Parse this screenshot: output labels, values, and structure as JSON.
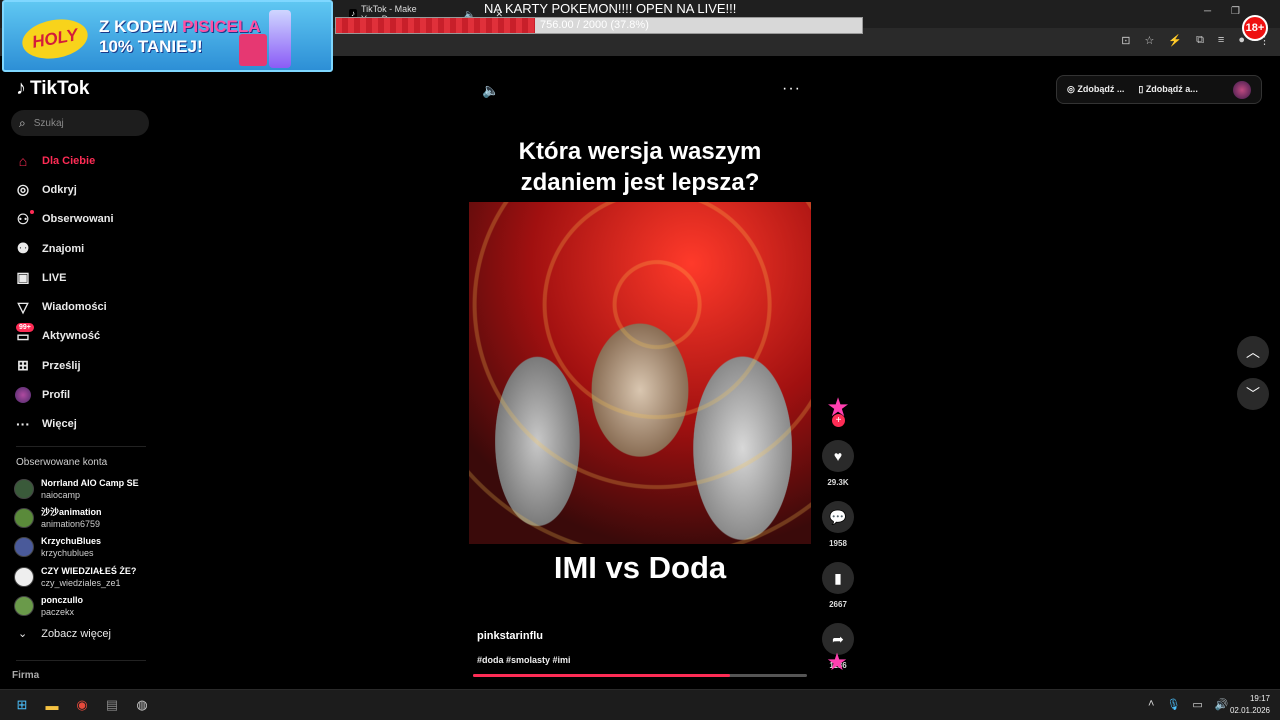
{
  "browser": {
    "tab_title": "TikTok - Make Your Day",
    "tab_icon": "tiktok-favicon"
  },
  "overlay": {
    "ad_text_line1_a": "Z KODEM ",
    "ad_text_line1_b": "PISICELA",
    "ad_text_line2": "10% TANIEJ!",
    "ad_logo": "HOLY",
    "stream_title": "NA KARTY POKEMON!!!! OPEN NA LIVE!!!",
    "progress_text": "756.00 / 2000 (37.8%)",
    "progress_fraction": 0.378,
    "badge": "18+"
  },
  "tiktok": {
    "logo_text": "TikTok",
    "search_placeholder": "Szukaj",
    "nav": [
      {
        "label": "Dla Ciebie",
        "icon": "home-icon",
        "active": true
      },
      {
        "label": "Odkryj",
        "icon": "compass-icon"
      },
      {
        "label": "Obserwowani",
        "icon": "following-icon"
      },
      {
        "label": "Znajomi",
        "icon": "friends-icon"
      },
      {
        "label": "LIVE",
        "icon": "live-icon"
      },
      {
        "label": "Wiadomości",
        "icon": "messages-icon"
      },
      {
        "label": "Aktywność",
        "icon": "activity-icon",
        "badge": "99+"
      },
      {
        "label": "Prześlij",
        "icon": "upload-icon"
      },
      {
        "label": "Profil",
        "icon": "profile-avatar"
      },
      {
        "label": "Więcej",
        "icon": "more-icon"
      }
    ],
    "followed_title": "Obserwowane konta",
    "followed": [
      {
        "name": "Norrland AIO Camp SE",
        "handle": "naiocamp"
      },
      {
        "name": "沙沙animation",
        "handle": "animation6759"
      },
      {
        "name": "KrzychuBlues",
        "handle": "krzychublues"
      },
      {
        "name": "CZY WIEDZIAŁEŚ ŻE?",
        "handle": "czy_wiedziales_ze1"
      },
      {
        "name": "ponczullo",
        "handle": "paczekx"
      }
    ],
    "see_more": "Zobacz więcej",
    "footer_title": "Firma",
    "top_right": {
      "btn1": "Zdobądź ...",
      "btn2": "Zdobądź a..."
    }
  },
  "video": {
    "headline": "Która wersja waszym zdaniem jest lepsza?",
    "caption": "IMI vs Doda",
    "author": "pinkstarinflu",
    "tags": "#doda #smolasty #imi",
    "progress_fraction": 0.77,
    "likes": "29.3K",
    "comments": "1958",
    "saves": "2667",
    "shares": "1186"
  },
  "taskbar": {
    "time": "19:17",
    "date": "02.01.2026"
  }
}
